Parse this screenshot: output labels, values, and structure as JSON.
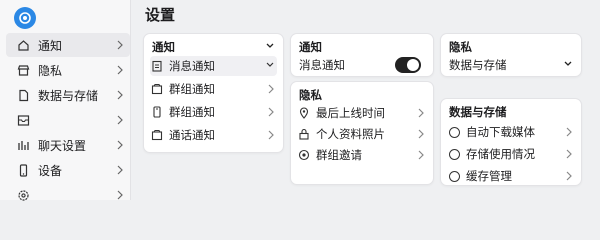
{
  "sidebar": {
    "items": [
      {
        "label": "通知",
        "icon": "home-icon"
      },
      {
        "label": "隐私",
        "icon": "store-icon"
      },
      {
        "label": "数据与存储",
        "icon": "file-icon"
      },
      {
        "label": "",
        "icon": "inbox-icon"
      },
      {
        "label": "聊天设置",
        "icon": "chart-icon"
      },
      {
        "label": "设备",
        "icon": "mobile-icon"
      },
      {
        "label": "",
        "icon": "gear-icon"
      }
    ]
  },
  "page": {
    "title": "设置"
  },
  "panel1": {
    "title": "通知",
    "items": [
      {
        "label": "消息通知",
        "icon": "clipboard-icon"
      },
      {
        "label": "群组通知",
        "icon": "box-icon"
      },
      {
        "label": "群组通知",
        "icon": "phone-icon"
      },
      {
        "label": "通话通知",
        "icon": "box-icon"
      }
    ]
  },
  "panel2": {
    "title": "通知",
    "toggle_label": "消息通知",
    "toggle_on": true
  },
  "panel3": {
    "title": "隐私",
    "items": [
      {
        "label": "最后上线时间",
        "icon": "location-icon"
      },
      {
        "label": "个人资料照片",
        "icon": "lock-icon"
      },
      {
        "label": "群组邀请",
        "icon": "target-icon"
      }
    ]
  },
  "panel4": {
    "title": "隐私",
    "dropdown_label": "数据与存储"
  },
  "panel5": {
    "title": "数据与存储",
    "items": [
      {
        "label": "自动下载媒体"
      },
      {
        "label": "存储使用情况"
      },
      {
        "label": "缓存管理"
      }
    ]
  },
  "colors": {
    "accent": "#2b88e5",
    "toggle": "#222222",
    "background": "#eff0f2"
  }
}
